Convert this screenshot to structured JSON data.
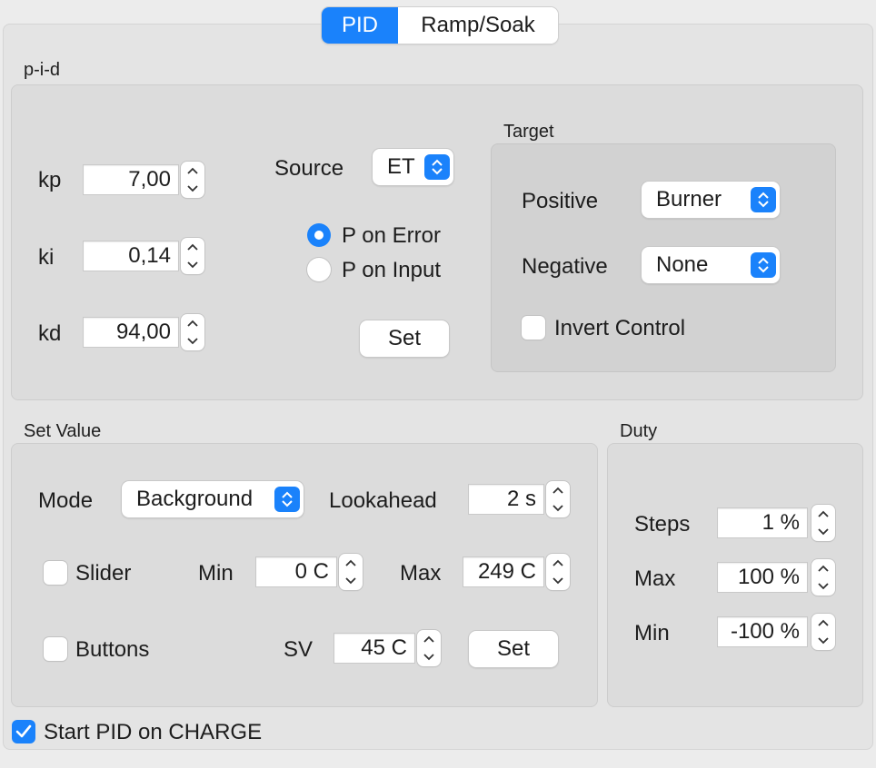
{
  "tabs": [
    {
      "label": "PID",
      "active": true
    },
    {
      "label": "Ramp/Soak",
      "active": false
    }
  ],
  "pid": {
    "title": "p-i-d",
    "kp": {
      "label": "kp",
      "value": "7,00"
    },
    "ki": {
      "label": "ki",
      "value": "0,14"
    },
    "kd": {
      "label": "kd",
      "value": "94,00"
    },
    "source": {
      "label": "Source",
      "value": "ET"
    },
    "p_on_error": {
      "label": "P on Error",
      "selected": true
    },
    "p_on_input": {
      "label": "P on Input",
      "selected": false
    },
    "set_label": "Set"
  },
  "target": {
    "title": "Target",
    "positive": {
      "label": "Positive",
      "value": "Burner"
    },
    "negative": {
      "label": "Negative",
      "value": "None"
    },
    "invert_control": {
      "label": "Invert Control",
      "checked": false
    }
  },
  "set_value": {
    "title": "Set Value",
    "mode": {
      "label": "Mode",
      "value": "Background"
    },
    "lookahead": {
      "label": "Lookahead",
      "value": "2 s"
    },
    "slider": {
      "label": "Slider",
      "checked": false
    },
    "min": {
      "label": "Min",
      "value": "0 C"
    },
    "max": {
      "label": "Max",
      "value": "249 C"
    },
    "buttons": {
      "label": "Buttons",
      "checked": false
    },
    "sv": {
      "label": "SV",
      "value": "45 C"
    },
    "set_label": "Set"
  },
  "duty": {
    "title": "Duty",
    "steps": {
      "label": "Steps",
      "value": "1 %"
    },
    "max": {
      "label": "Max",
      "value": "100 %"
    },
    "min": {
      "label": "Min",
      "value": "-100 %"
    }
  },
  "start_pid_on_charge": {
    "label": "Start PID on CHARGE",
    "checked": true
  },
  "colors": {
    "accent": "#1a82fb",
    "window_bg": "#ececec",
    "group_bg": "#dcdcdc",
    "inner_group_bg": "#d2d2d2"
  }
}
